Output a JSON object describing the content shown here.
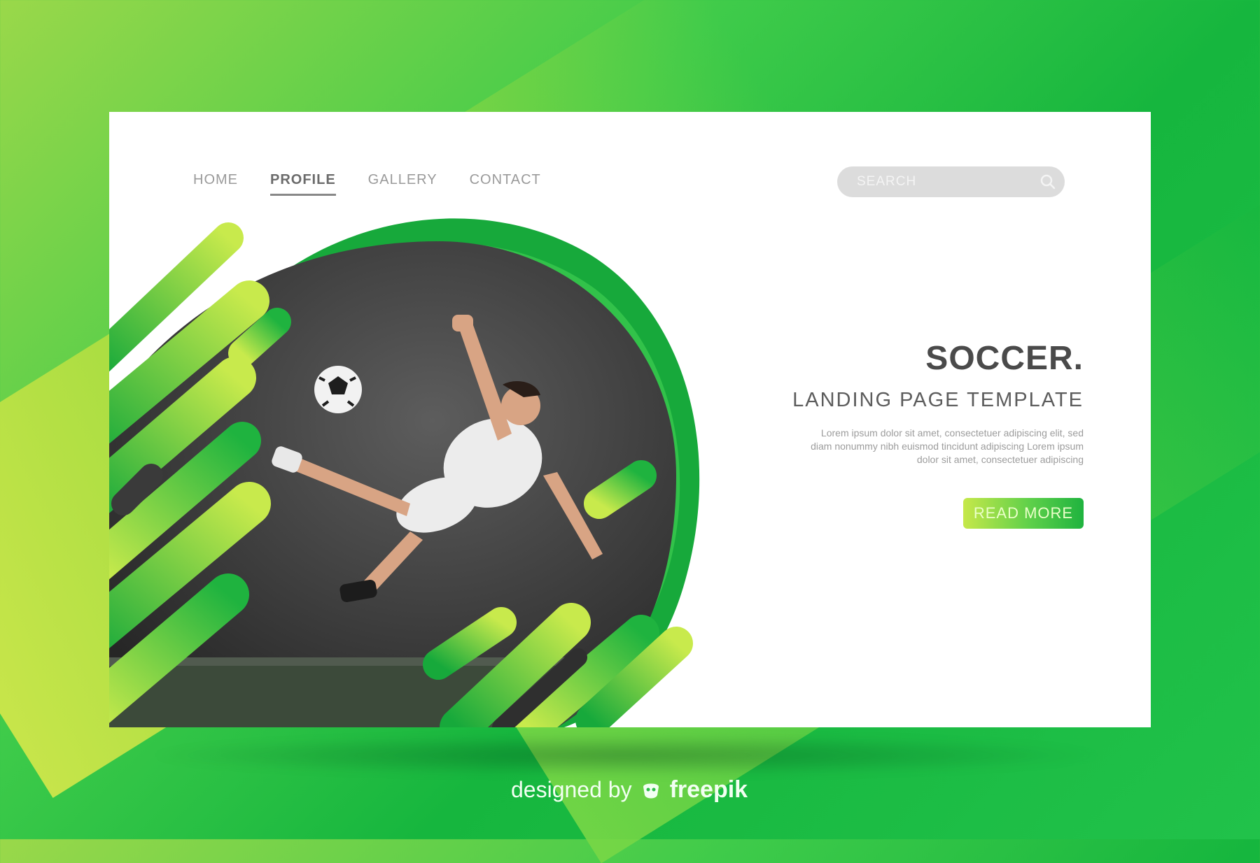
{
  "nav": {
    "items": [
      {
        "label": "HOME",
        "active": false
      },
      {
        "label": "PROFILE",
        "active": true
      },
      {
        "label": "GALLERY",
        "active": false
      },
      {
        "label": "CONTACT",
        "active": false
      }
    ]
  },
  "search": {
    "placeholder": "SEARCH",
    "icon": "search-icon"
  },
  "hero": {
    "title": "SOCCER.",
    "subtitle": "LANDING PAGE TEMPLATE",
    "body": "Lorem ipsum dolor sit amet, consectetuer adipiscing elit, sed diam nonummy nibh euismod tincidunt adipiscing Lorem ipsum dolor sit amet, consectetuer adipiscing",
    "cta_label": "READ MORE"
  },
  "footer": {
    "designed_by": "designed by",
    "brand": "freepik"
  },
  "colors": {
    "accent_dark": "#13a23a",
    "accent_light": "#c6e84a",
    "text_dark": "#4a4a4a"
  }
}
